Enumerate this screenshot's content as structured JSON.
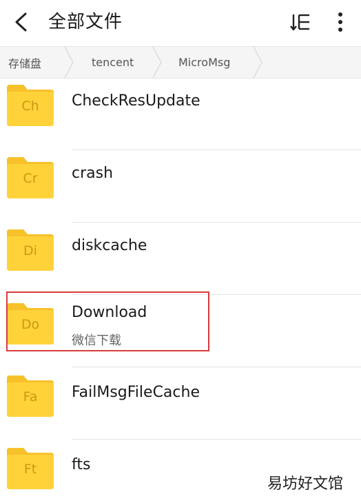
{
  "header": {
    "title": "全部文件",
    "back_icon": "chevron-left-icon",
    "sort_icon": "sort-list-icon",
    "more_icon": "more-vertical-icon"
  },
  "breadcrumb": {
    "items": [
      "存储盘",
      "tencent",
      "MicroMsg"
    ]
  },
  "files": [
    {
      "abbr": "Ch",
      "name": "CheckResUpdate",
      "subtitle": ""
    },
    {
      "abbr": "Cr",
      "name": "crash",
      "subtitle": ""
    },
    {
      "abbr": "Di",
      "name": "diskcache",
      "subtitle": ""
    },
    {
      "abbr": "Do",
      "name": "Download",
      "subtitle": "微信下载"
    },
    {
      "abbr": "Fa",
      "name": "FailMsgFileCache",
      "subtitle": ""
    },
    {
      "abbr": "Ft",
      "name": "fts",
      "subtitle": ""
    }
  ],
  "colors": {
    "folder": "#FFD23A",
    "folder_tab": "#F7C12A",
    "highlight": "#D93A3A"
  },
  "watermark": "易坊好文馆"
}
